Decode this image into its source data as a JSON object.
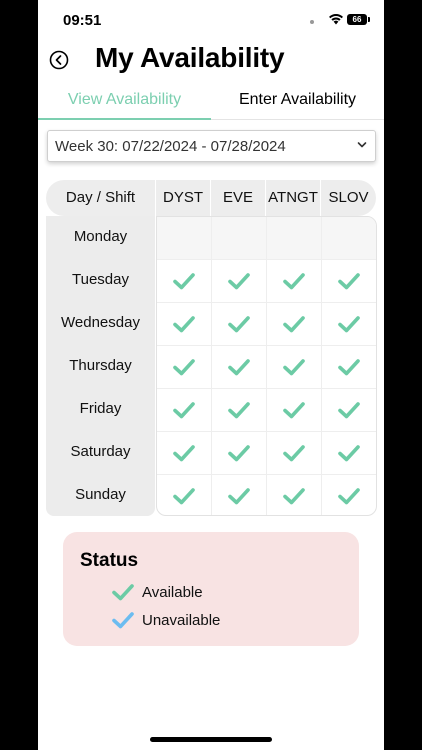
{
  "status_bar": {
    "time": "09:51",
    "battery": "66"
  },
  "header": {
    "title": "My Availability"
  },
  "tabs": [
    {
      "label": "View Availability",
      "active": true
    },
    {
      "label": "Enter Availability",
      "active": false
    }
  ],
  "week_select": {
    "value": "Week 30: 07/22/2024 - 07/28/2024"
  },
  "grid": {
    "corner_label": "Day / Shift",
    "shifts": [
      "DYST",
      "EVE",
      "ATNGT",
      "SLOV"
    ],
    "days": [
      "Monday",
      "Tuesday",
      "Wednesday",
      "Thursday",
      "Friday",
      "Saturday",
      "Sunday"
    ],
    "availability": [
      [
        false,
        false,
        false,
        false
      ],
      [
        true,
        true,
        true,
        true
      ],
      [
        true,
        true,
        true,
        true
      ],
      [
        true,
        true,
        true,
        true
      ],
      [
        true,
        true,
        true,
        true
      ],
      [
        true,
        true,
        true,
        true
      ],
      [
        true,
        true,
        true,
        true
      ]
    ]
  },
  "status": {
    "title": "Status",
    "legend": [
      {
        "label": "Available",
        "color": "#6ccba5"
      },
      {
        "label": "Unavailable",
        "color": "#6cbcf0"
      }
    ]
  },
  "colors": {
    "accent": "#7ccfb0",
    "status_bg": "#f8e3e3"
  }
}
